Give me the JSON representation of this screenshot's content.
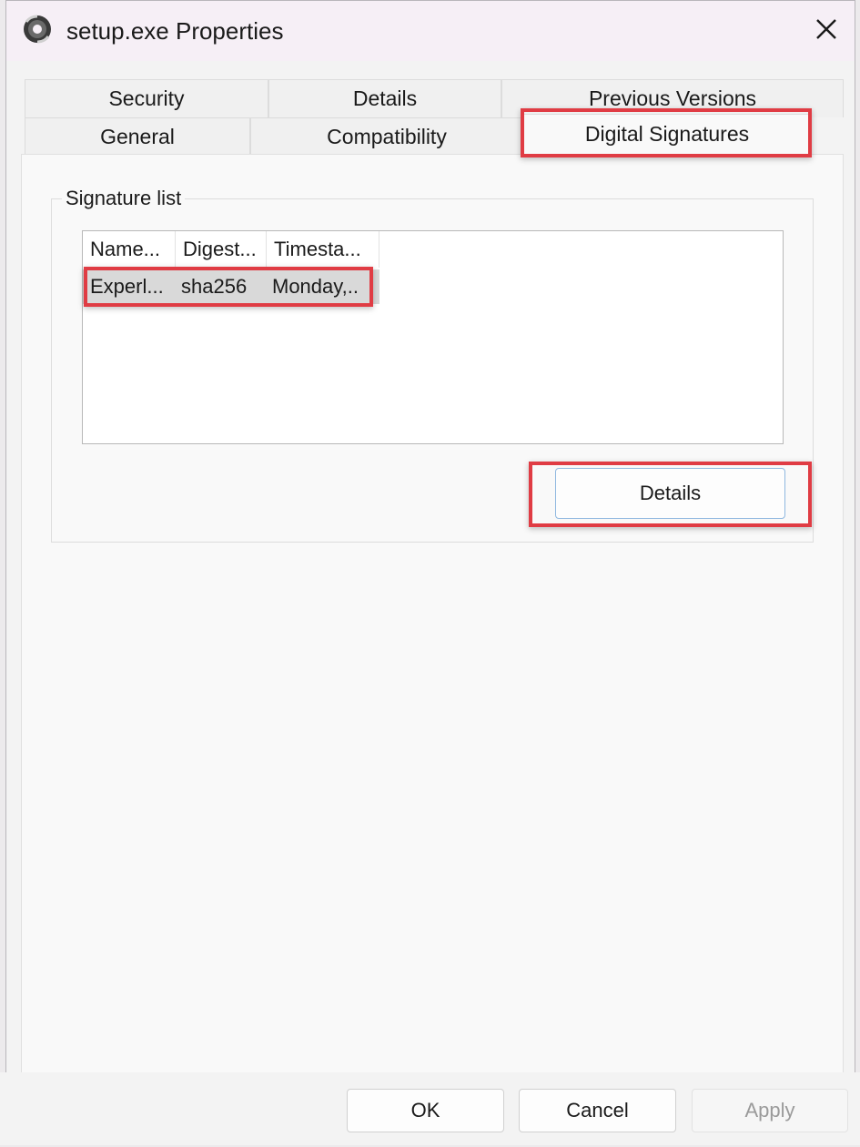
{
  "window": {
    "title": "setup.exe Properties"
  },
  "tabs": {
    "row_back": [
      {
        "label": "Security"
      },
      {
        "label": "Details"
      },
      {
        "label": "Previous Versions"
      }
    ],
    "row_front": [
      {
        "label": "General"
      },
      {
        "label": "Compatibility"
      },
      {
        "label": "Digital Signatures",
        "active": true
      }
    ]
  },
  "signature_list": {
    "label": "Signature list",
    "columns": [
      "Name...",
      "Digest...",
      "Timesta..."
    ],
    "rows": [
      {
        "name": "Experl...",
        "digest": "sha256",
        "timestamp": "Monday,..",
        "selected": true
      }
    ]
  },
  "details_button": {
    "label": "Details"
  },
  "footer": {
    "ok_label": "OK",
    "cancel_label": "Cancel",
    "apply_label": "Apply",
    "apply_enabled": false
  },
  "icons": {
    "app": "disc-setup-icon",
    "close": "close-icon"
  },
  "colors": {
    "highlight": "#e03c44",
    "titlebar": "#f6eff6",
    "selected_row": "#d9d9d9"
  }
}
